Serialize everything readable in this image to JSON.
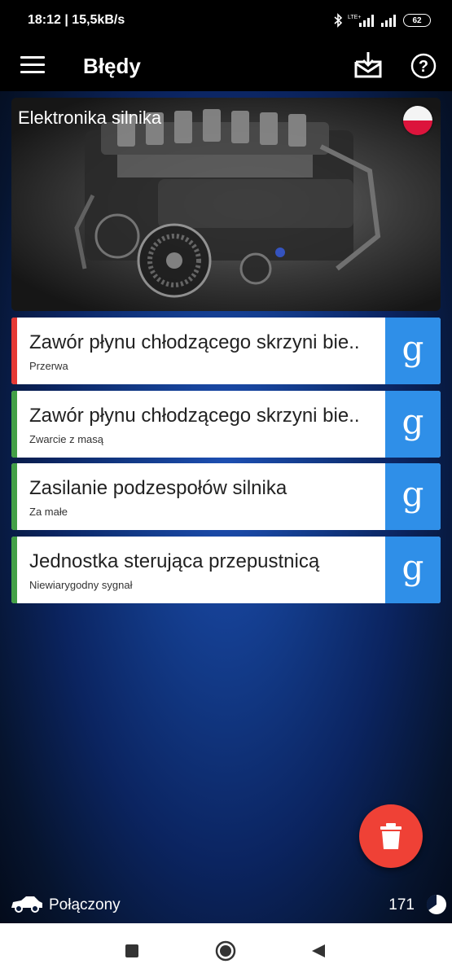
{
  "status_bar": {
    "time_speed": "18:12 | 15,5kB/s",
    "network": "LTE+",
    "battery": "62"
  },
  "app_bar": {
    "title": "Błędy",
    "icons": [
      "menu-icon",
      "download-icon",
      "help-icon"
    ]
  },
  "banner": {
    "label": "Elektronika silnika",
    "flag": "poland-flag"
  },
  "errors": [
    {
      "title": "Zawór płynu chłodzącego skrzyni bie..",
      "subtitle": "Przerwa",
      "status_color": "#e53935",
      "search_glyph": "g"
    },
    {
      "title": "Zawór płynu chłodzącego skrzyni bie..",
      "subtitle": "Zwarcie z masą",
      "status_color": "#43a047",
      "search_glyph": "g"
    },
    {
      "title": "Zasilanie podzespołów silnika",
      "subtitle": "Za małe",
      "status_color": "#43a047",
      "search_glyph": "g"
    },
    {
      "title": "Jednostka sterująca przepustnicą",
      "subtitle": "Niewiarygodny sygnał",
      "status_color": "#43a047",
      "search_glyph": "g"
    }
  ],
  "fab": {
    "icon": "trash-icon",
    "color": "#ef4136"
  },
  "footer": {
    "connection": "Połączony",
    "count": "171"
  },
  "colors": {
    "accent_blue": "#2f8fe8",
    "error_red": "#e53935",
    "ok_green": "#43a047"
  }
}
